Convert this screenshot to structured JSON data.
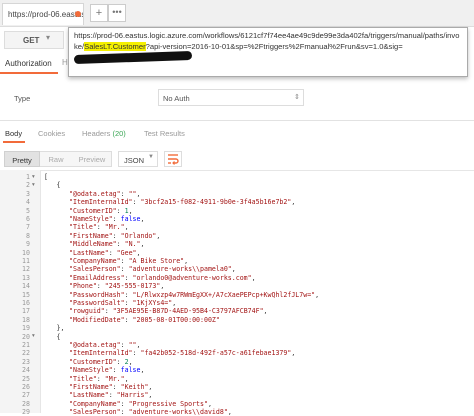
{
  "tabs": [
    {
      "label": "https://prod-06.eastus"
    }
  ],
  "request": {
    "method": "GET",
    "url_parts": [
      "https://prod-06.eastus.logic.azure.com/workflows/6121cf7f74ee4ae49c9de99e3da402fa/triggers/manual/paths/invoke/",
      "SalesLT.Customer",
      "?api-version=2016-10-01&sp=%2Ftriggers%2Fmanual%2Frun&sv=1.0&sig="
    ]
  },
  "auth_tabs": {
    "authorization": "Authorization",
    "headers_partial": "H"
  },
  "auth": {
    "type_label": "Type",
    "type_value": "No Auth"
  },
  "response_tabs": {
    "body": "Body",
    "cookies": "Cookies",
    "headers": "Headers",
    "headers_count": "(20)",
    "tests": "Test Results"
  },
  "format": {
    "pretty": "Pretty",
    "raw": "Raw",
    "preview": "Preview",
    "language": "JSON"
  },
  "colors": {
    "accent": "#f26b3a",
    "highlight": "#f4f000",
    "count_green": "#3aa655"
  },
  "response_lines": [
    {
      "n": "1",
      "fold": true,
      "indent": 0,
      "text": "["
    },
    {
      "n": "2",
      "fold": true,
      "indent": 1,
      "text": "{"
    },
    {
      "n": "3",
      "indent": 2,
      "key": "@odata.etag",
      "val": "\"\"",
      "vt": "s"
    },
    {
      "n": "4",
      "indent": 2,
      "key": "ItemInternalId",
      "val": "\"3bcf2a15-f082-4911-9b0e-3f4a5b16e7b2\"",
      "vt": "s"
    },
    {
      "n": "5",
      "indent": 2,
      "key": "CustomerID",
      "val": "1",
      "vt": "n"
    },
    {
      "n": "6",
      "indent": 2,
      "key": "NameStyle",
      "val": "false",
      "vt": "b"
    },
    {
      "n": "7",
      "indent": 2,
      "key": "Title",
      "val": "\"Mr.\"",
      "vt": "s"
    },
    {
      "n": "8",
      "indent": 2,
      "key": "FirstName",
      "val": "\"Orlando\"",
      "vt": "s"
    },
    {
      "n": "9",
      "indent": 2,
      "key": "MiddleName",
      "val": "\"N.\"",
      "vt": "s"
    },
    {
      "n": "10",
      "indent": 2,
      "key": "LastName",
      "val": "\"Gee\"",
      "vt": "s"
    },
    {
      "n": "11",
      "indent": 2,
      "key": "CompanyName",
      "val": "\"A Bike Store\"",
      "vt": "s"
    },
    {
      "n": "12",
      "indent": 2,
      "key": "SalesPerson",
      "val": "\"adventure-works\\\\pamela0\"",
      "vt": "s"
    },
    {
      "n": "13",
      "indent": 2,
      "key": "EmailAddress",
      "val": "\"orlando0@adventure-works.com\"",
      "vt": "s"
    },
    {
      "n": "14",
      "indent": 2,
      "key": "Phone",
      "val": "\"245-555-0173\"",
      "vt": "s"
    },
    {
      "n": "15",
      "indent": 2,
      "key": "PasswordHash",
      "val": "\"L/Rlwxzp4w7RWmEgXX+/A7cXaePEPcp+KwQhl2fJL7w=\"",
      "vt": "s"
    },
    {
      "n": "16",
      "indent": 2,
      "key": "PasswordSalt",
      "val": "\"1KjXYs4=\"",
      "vt": "s"
    },
    {
      "n": "17",
      "indent": 2,
      "key": "rowguid",
      "val": "\"3F5AE95E-B87D-4AED-95B4-C3797AFCB74F\"",
      "vt": "s"
    },
    {
      "n": "18",
      "indent": 2,
      "key": "ModifiedDate",
      "val": "\"2005-08-01T00:00:00Z\"",
      "vt": "s",
      "last": true
    },
    {
      "n": "19",
      "indent": 1,
      "text": "},"
    },
    {
      "n": "20",
      "fold": true,
      "indent": 1,
      "text": "{"
    },
    {
      "n": "21",
      "indent": 2,
      "key": "@odata.etag",
      "val": "\"\"",
      "vt": "s"
    },
    {
      "n": "22",
      "indent": 2,
      "key": "ItemInternalId",
      "val": "\"fa42b052-518d-492f-a57c-a61febae1379\"",
      "vt": "s"
    },
    {
      "n": "23",
      "indent": 2,
      "key": "CustomerID",
      "val": "2",
      "vt": "n"
    },
    {
      "n": "24",
      "indent": 2,
      "key": "NameStyle",
      "val": "false",
      "vt": "b"
    },
    {
      "n": "25",
      "indent": 2,
      "key": "Title",
      "val": "\"Mr.\"",
      "vt": "s"
    },
    {
      "n": "26",
      "indent": 2,
      "key": "FirstName",
      "val": "\"Keith\"",
      "vt": "s"
    },
    {
      "n": "27",
      "indent": 2,
      "key": "LastName",
      "val": "\"Harris\"",
      "vt": "s"
    },
    {
      "n": "28",
      "indent": 2,
      "key": "CompanyName",
      "val": "\"Progressive Sports\"",
      "vt": "s"
    },
    {
      "n": "29",
      "indent": 2,
      "key": "SalesPerson",
      "val": "\"adventure-works\\\\david8\"",
      "vt": "s"
    }
  ]
}
